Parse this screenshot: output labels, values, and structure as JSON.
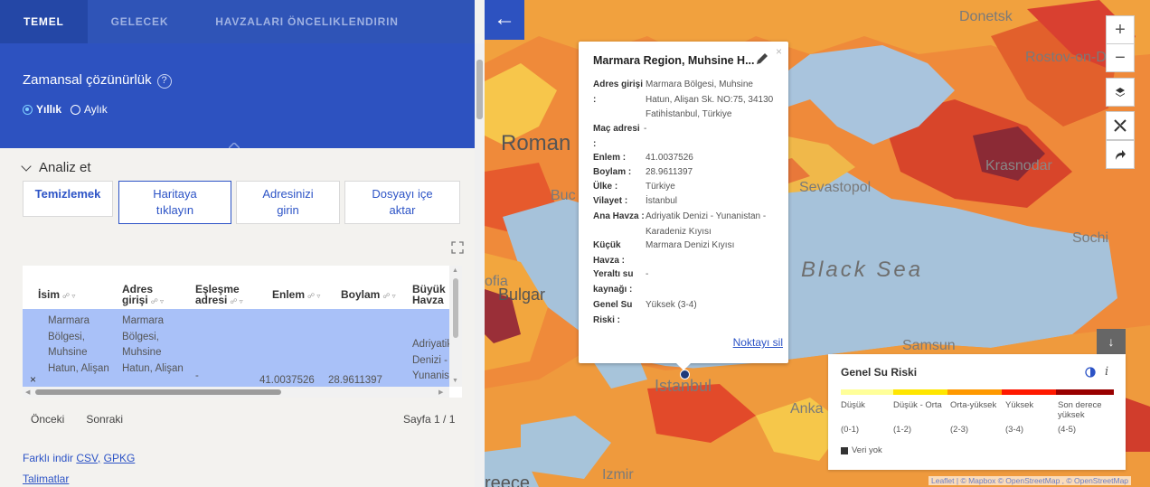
{
  "tabs": [
    {
      "label": "TEMEL",
      "active": true
    },
    {
      "label": "GELECEK",
      "active": false
    },
    {
      "label": "HAVZALARI ÖNCELIKLENDIRIN",
      "active": false
    }
  ],
  "resolution": {
    "title": "Zamansal çözünürlük",
    "help": "?",
    "options": [
      {
        "label": "Yıllık",
        "selected": true
      },
      {
        "label": "Aylık",
        "selected": false
      }
    ]
  },
  "analyze": {
    "title": "Analiz et"
  },
  "actions": {
    "clear": "Temizlemek",
    "click_map": "Haritaya tıklayın",
    "enter_address": "Adresinizi girin",
    "import_file": "Dosyayı içe aktar"
  },
  "table": {
    "headers": [
      "İsim",
      "Adres girişi",
      "Eşleşme adresi",
      "Enlem",
      "Boylam",
      "Büyük Havza"
    ],
    "row": {
      "name": "Marmara Bölgesi, Muhsine Hatun, Alişan",
      "address": "Marmara Bölgesi, Muhsine Hatun, Alişan",
      "match": "-",
      "lat": "41.0037526",
      "lon": "28.9611397",
      "basin": "Adriyatik Denizi - Yunanis"
    },
    "delete_icon": "×"
  },
  "pagination": {
    "prev": "Önceki",
    "next": "Sonraki",
    "page": "Sayfa 1 / 1"
  },
  "download": {
    "prefix": "Farklı indir",
    "csv": "CSV,",
    "gpkg": "GPKG"
  },
  "instructions": "Talimatlar",
  "map": {
    "labels": {
      "donetsk": "Donetsk",
      "rostov": "Rostov-on-Don",
      "roman": "Roman",
      "buc": "Buc",
      "sevastopol": "Sevastopol",
      "krasnodar": "Krasnodar",
      "sochi": "Sochi",
      "black_sea": "Black Sea",
      "ofia": "ofia",
      "bulgar": "Bulgar",
      "samsun": "Samsun",
      "istanbul": "Istanbul",
      "anka": "Anka",
      "izmir": "Izmir",
      "reece": "reece"
    },
    "zoom_in": "+",
    "zoom_out": "−",
    "attribution": "Leaflet | © Mapbox © OpenStreetMap , © OpenStreetMap"
  },
  "popup": {
    "title": "Marmara Region, Muhsine H...",
    "close": "×",
    "fields": [
      {
        "label": "Adres girişi :",
        "value": "Marmara Bölgesi, Muhsine Hatun, Alişan Sk. NO:75, 34130 Fatihİstanbul, Türkiye"
      },
      {
        "label": "Maç adresi :",
        "value": "-"
      },
      {
        "label": "Enlem :",
        "value": "41.0037526"
      },
      {
        "label": "Boylam :",
        "value": "28.9611397"
      },
      {
        "label": "Ülke :",
        "value": "Türkiye"
      },
      {
        "label": "Vilayet :",
        "value": "İstanbul"
      },
      {
        "label": "Ana Havza :",
        "value": "Adriyatik Denizi - Yunanistan - Karadeniz Kıyısı"
      },
      {
        "label": "Küçük Havza :",
        "value": "Marmara Denizi Kıyısı"
      },
      {
        "label": "Yeraltı su kaynağı :",
        "value": "-"
      },
      {
        "label": "Genel Su Riski :",
        "value": "Yüksek (3-4)"
      }
    ],
    "delete": "Noktayı sil"
  },
  "legend": {
    "title": "Genel Su Riski",
    "info": "i",
    "classes": [
      {
        "label": "Düşük",
        "range": "(0-1)",
        "color": "#ffff99"
      },
      {
        "label": "Düşük - Orta",
        "range": "(1-2)",
        "color": "#ffe600"
      },
      {
        "label": "Orta-yüksek",
        "range": "(2-3)",
        "color": "#ff9900"
      },
      {
        "label": "Yüksek",
        "range": "(3-4)",
        "color": "#ff1900"
      },
      {
        "label": "Son derece yüksek",
        "range": "(4-5)",
        "color": "#990000"
      }
    ],
    "no_data": "Veri yok"
  }
}
